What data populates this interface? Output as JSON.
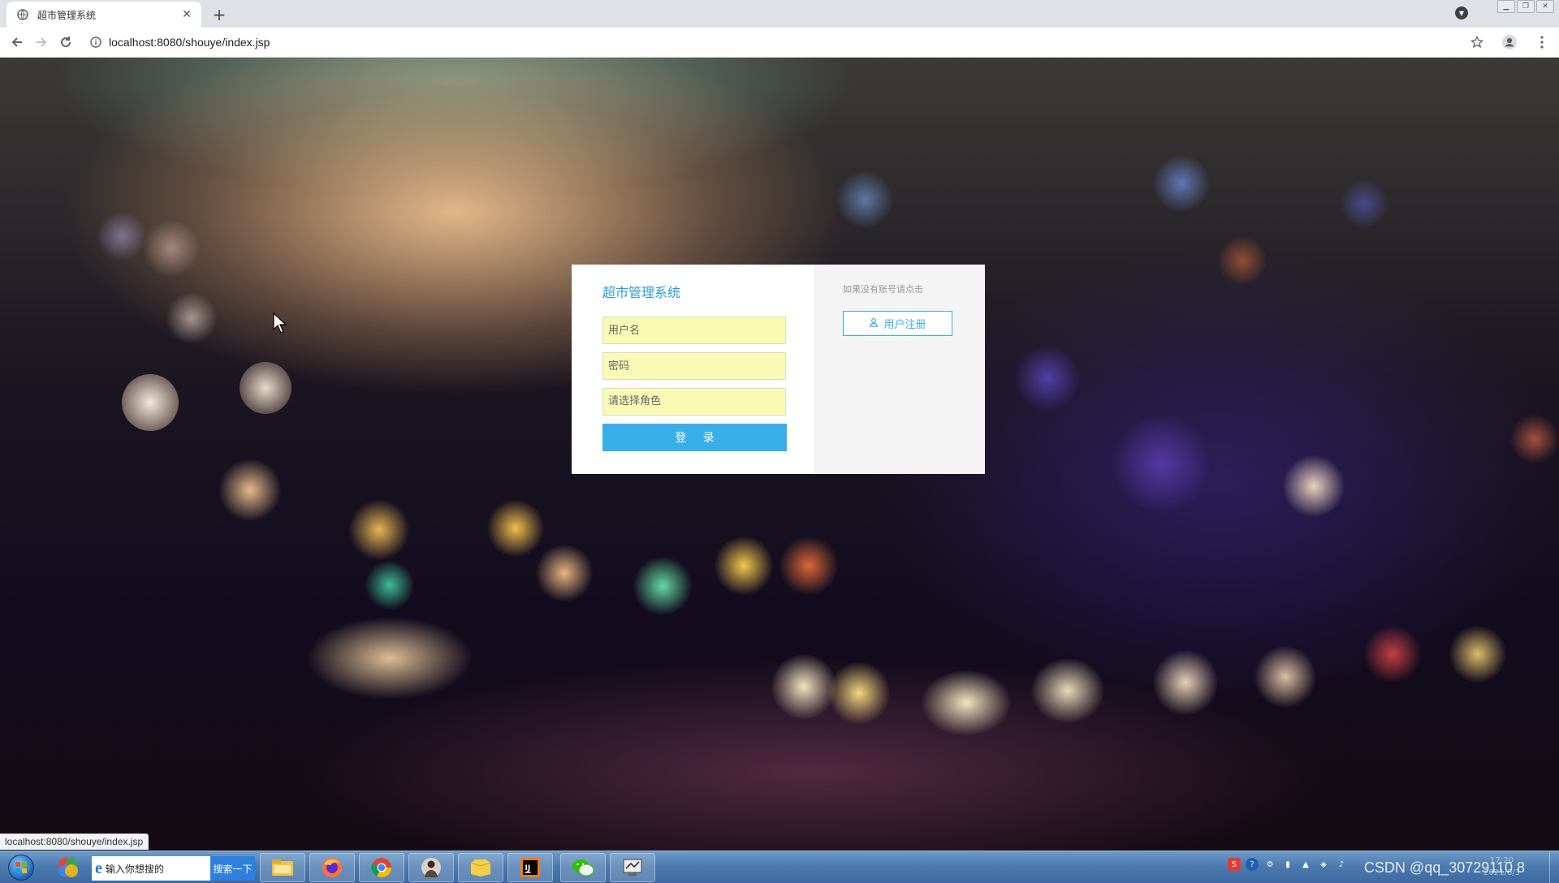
{
  "browser": {
    "tab_title": "超市管理系统",
    "url": "localhost:8080/shouye/index.jsp",
    "status_url": "localhost:8080/shouye/index.jsp"
  },
  "login": {
    "system_title": "超市管理系统",
    "username_placeholder": "用户名",
    "password_placeholder": "密码",
    "role_placeholder": "请选择角色",
    "login_label": "登 录",
    "register_hint": "如果没有账号请点击",
    "register_label": "用户注册",
    "accent_color": "#3aaee8",
    "input_bg_color": "#f9fbb5"
  },
  "taskbar": {
    "search_placeholder": "输入你想搜的",
    "search_button": "搜索一下",
    "clock_time": "17:20",
    "clock_date": "2021/6/3",
    "watermark": "CSDN @qq_30729110 8",
    "apps": [
      "ie-icon",
      "file-explorer-icon",
      "firefox-icon",
      "chrome-icon",
      "user-app-icon",
      "folder-icon",
      "intellij-icon",
      "wechat-icon",
      "control-panel-icon"
    ]
  }
}
